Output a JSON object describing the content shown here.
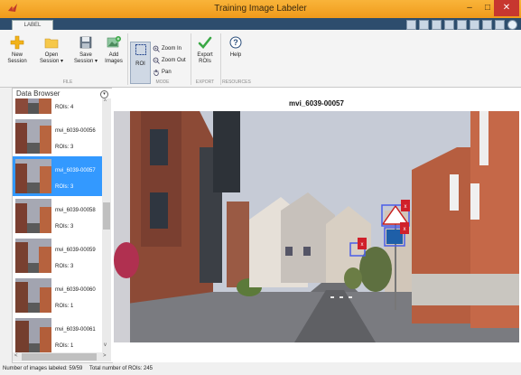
{
  "window": {
    "title": "Training Image Labeler",
    "min_icon": "minimize-icon",
    "max_icon": "maximize-icon",
    "close_icon": "close-icon"
  },
  "tabs": [
    {
      "label": "LABEL"
    }
  ],
  "toolstrip": {
    "file": {
      "group_label": "FILE",
      "new_session": [
        "New",
        "Session"
      ],
      "open_session": [
        "Open",
        "Session ▾"
      ],
      "save_session": [
        "Save",
        "Session ▾"
      ],
      "add_images": [
        "Add",
        "Images"
      ]
    },
    "mode": {
      "group_label": "MODE",
      "roi": "ROI",
      "zoom_in": "Zoom In",
      "zoom_out": "Zoom Out",
      "pan": "Pan"
    },
    "export": {
      "group_label": "EXPORT",
      "export_rois": [
        "Export",
        "ROIs"
      ]
    },
    "resources": {
      "group_label": "RESOURCES",
      "help": "Help"
    }
  },
  "data_browser": {
    "title": "Data Browser",
    "items": [
      {
        "name": "",
        "rois": "ROIs: 4",
        "selected": false
      },
      {
        "name": "mvi_6039-00056",
        "rois": "ROIs: 3",
        "selected": false
      },
      {
        "name": "mvi_6039-00057",
        "rois": "ROIs: 3",
        "selected": true
      },
      {
        "name": "mvi_6039-00058",
        "rois": "ROIs: 3",
        "selected": false
      },
      {
        "name": "mvi_6039-00059",
        "rois": "ROIs: 3",
        "selected": false
      },
      {
        "name": "mvi_6039-00060",
        "rois": "ROIs: 1",
        "selected": false
      },
      {
        "name": "mvi_6039-00061",
        "rois": "ROIs: 1",
        "selected": false
      }
    ]
  },
  "viewer": {
    "image_title": "mvi_6039-00057",
    "roi_badge": "x"
  },
  "status": {
    "labeled": "Number of images labeled: 59/59",
    "total_rois": "Total number of ROIs: 245"
  },
  "colors": {
    "titlebar": "#f5a623",
    "selection": "#3399ff",
    "roi_box": "#4a5ee8",
    "roi_badge": "#d0202a"
  }
}
